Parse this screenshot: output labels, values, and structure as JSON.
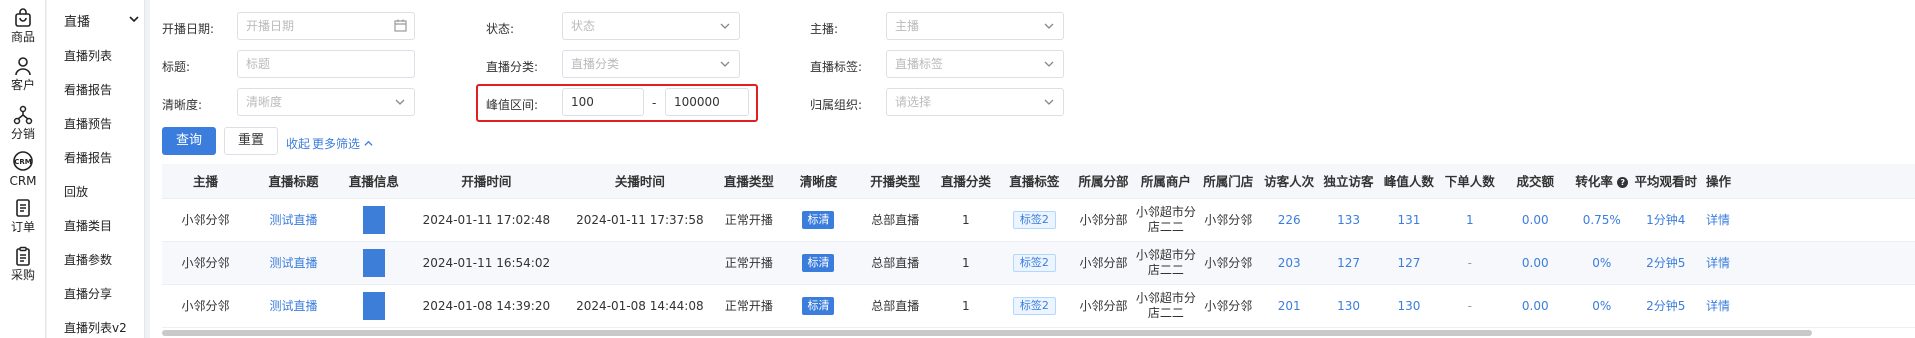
{
  "rail": [
    {
      "label": "商品",
      "icon": "bag-icon"
    },
    {
      "label": "客户",
      "icon": "user-icon"
    },
    {
      "label": "分销",
      "icon": "network-icon"
    },
    {
      "label": "CRM",
      "icon": "crm-icon"
    },
    {
      "label": "订单",
      "icon": "document-icon"
    },
    {
      "label": "采购",
      "icon": "clipboard-icon"
    }
  ],
  "submenu": {
    "title": "直播",
    "items": [
      "直播列表",
      "看播报告",
      "直播预告",
      "看播报告",
      "回放",
      "直播类目",
      "直播参数",
      "直播分享",
      "直播列表v2"
    ]
  },
  "filters": {
    "open_date": {
      "label": "开播日期:",
      "placeholder": "开播日期"
    },
    "status": {
      "label": "状态:",
      "placeholder": "状态"
    },
    "host": {
      "label": "主播:",
      "placeholder": "主播"
    },
    "title": {
      "label": "标题:",
      "placeholder": "标题"
    },
    "category": {
      "label": "直播分类:",
      "placeholder": "直播分类"
    },
    "tag": {
      "label": "直播标签:",
      "placeholder": "直播标签"
    },
    "resolution": {
      "label": "清晰度:",
      "placeholder": "清晰度"
    },
    "peak": {
      "label": "峰值区间:",
      "min": "100",
      "separator": "-",
      "max": "100000"
    },
    "org": {
      "label": "归属组织:",
      "placeholder": "请选择"
    }
  },
  "actions": {
    "query": "查询",
    "reset": "重置",
    "collapse": "收起",
    "more": "更多筛选"
  },
  "table": {
    "columns": [
      "主播",
      "直播标题",
      "直播信息",
      "开播时间",
      "关播时间",
      "直播类型",
      "清晰度",
      "开播类型",
      "直播分类",
      "直播标签",
      "所属分部",
      "所属商户",
      "所属门店",
      "访客人次",
      "独立访客",
      "峰值人数",
      "下单人数",
      "成交额",
      "转化率",
      "平均观看时",
      "操作"
    ],
    "rows": [
      {
        "host": "小邻分邻",
        "title": "测试直播",
        "open": "2024-01-11 17:02:48",
        "close": "2024-01-11 17:37:58",
        "type": "正常开播",
        "res": "标清",
        "open_type": "总部直播",
        "category": "1",
        "tag": "标签2",
        "branch": "小邻分部",
        "merchant": "小邻超市分店二二",
        "store": "小邻分邻",
        "visits": "226",
        "uv": "133",
        "peak": "131",
        "orders": "1",
        "gmv": "0.00",
        "conv": "0.75%",
        "avg": "1分钟4",
        "op": "详情"
      },
      {
        "host": "小邻分邻",
        "title": "测试直播",
        "open": "2024-01-11 16:54:02",
        "close": "",
        "type": "正常开播",
        "res": "标清",
        "open_type": "总部直播",
        "category": "1",
        "tag": "标签2",
        "branch": "小邻分部",
        "merchant": "小邻超市分店二二",
        "store": "小邻分邻",
        "visits": "203",
        "uv": "127",
        "peak": "127",
        "orders": "-",
        "gmv": "0.00",
        "conv": "0%",
        "avg": "2分钟5",
        "op": "详情"
      },
      {
        "host": "小邻分邻",
        "title": "测试直播",
        "open": "2024-01-08 14:39:20",
        "close": "2024-01-08 14:44:08",
        "type": "正常开播",
        "res": "标清",
        "open_type": "总部直播",
        "category": "1",
        "tag": "标签2",
        "branch": "小邻分部",
        "merchant": "小邻超市分店二二",
        "store": "小邻分邻",
        "visits": "201",
        "uv": "130",
        "peak": "130",
        "orders": "-",
        "gmv": "0.00",
        "conv": "0%",
        "avg": "2分钟5",
        "op": "详情"
      }
    ]
  },
  "colors": {
    "primary": "#3b7ddd",
    "highlight_border": "#e02020"
  }
}
